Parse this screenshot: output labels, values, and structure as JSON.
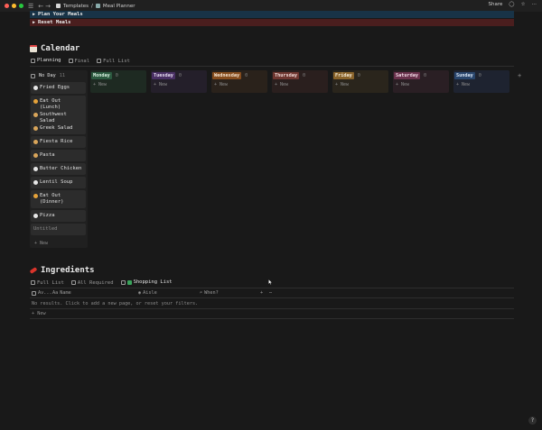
{
  "topbar": {
    "traffic_colors": [
      "#ff5f57",
      "#febc2e",
      "#28c840"
    ],
    "breadcrumb": [
      "Templates",
      "Meal Planner"
    ],
    "share_label": "Share"
  },
  "callouts": [
    {
      "label": "Plan Your Meals",
      "color": "#183347"
    },
    {
      "label": "Reset Meals",
      "color": "#4a1e1e"
    }
  ],
  "calendar": {
    "title": "Calendar",
    "tabs": [
      "Planning",
      "Final",
      "Full List"
    ],
    "no_day": {
      "label": "No Day",
      "count": "11"
    },
    "cards": [
      {
        "label": "Fried Eggs",
        "icon": "egg-icon",
        "color": "#e6e6e6"
      },
      {
        "label": "Eat Out (Lunch)",
        "icon": "taco-icon",
        "color": "#e5a23a"
      },
      {
        "label": "Southwest Salad",
        "icon": "burrito-icon",
        "color": "#d9a55a"
      },
      {
        "label": "Greek Salad",
        "icon": "burrito-icon",
        "color": "#d9a55a"
      },
      {
        "label": "Fiesta Rice",
        "icon": "burrito-icon",
        "color": "#d9a55a"
      },
      {
        "label": "Pasta",
        "icon": "burrito-icon",
        "color": "#d9a55a"
      },
      {
        "label": "Butter Chicken",
        "icon": "bowl-icon",
        "color": "#e6e6e6"
      },
      {
        "label": "Lentil Soup",
        "icon": "bowl-icon",
        "color": "#e6e6e6"
      },
      {
        "label": "Eat Out (Dinner)",
        "icon": "taco-icon",
        "color": "#e5a23a"
      },
      {
        "label": "Pizza",
        "icon": "bowl-icon",
        "color": "#e6e6e6"
      },
      {
        "label": "Untitled",
        "icon": "",
        "color": ""
      }
    ],
    "new_label": "+ New",
    "days": [
      {
        "label": "Monday",
        "count": "0",
        "pill": "#2b593f",
        "text": "#d7f0df",
        "bg": "#1e2a22"
      },
      {
        "label": "Tuesday",
        "count": "0",
        "pill": "#492f64",
        "text": "#e6dcf0",
        "bg": "#241f2a"
      },
      {
        "label": "Wednesday",
        "count": "0",
        "pill": "#854c1d",
        "text": "#f5e3cf",
        "bg": "#2a221b"
      },
      {
        "label": "Thursday",
        "count": "0",
        "pill": "#6e3630",
        "text": "#f2dcd9",
        "bg": "#2a1f1e"
      },
      {
        "label": "Friday",
        "count": "0",
        "pill": "#89632a",
        "text": "#f5ead5",
        "bg": "#2a251c"
      },
      {
        "label": "Saturday",
        "count": "0",
        "pill": "#69314c",
        "text": "#f2d9e6",
        "bg": "#2a1f24"
      },
      {
        "label": "Sunday",
        "count": "0",
        "pill": "#28456c",
        "text": "#d8e5f5",
        "bg": "#1e2330"
      }
    ]
  },
  "ingredients": {
    "title": "Ingredients",
    "tabs": [
      "Full List",
      "All Required",
      "Shopping List"
    ],
    "columns": [
      "Av...",
      "Name",
      "Aisle",
      "When?"
    ],
    "empty_text": "No results. Click to add a new page, or reset your filters.",
    "new_label": "+ New"
  },
  "help_label": "?"
}
